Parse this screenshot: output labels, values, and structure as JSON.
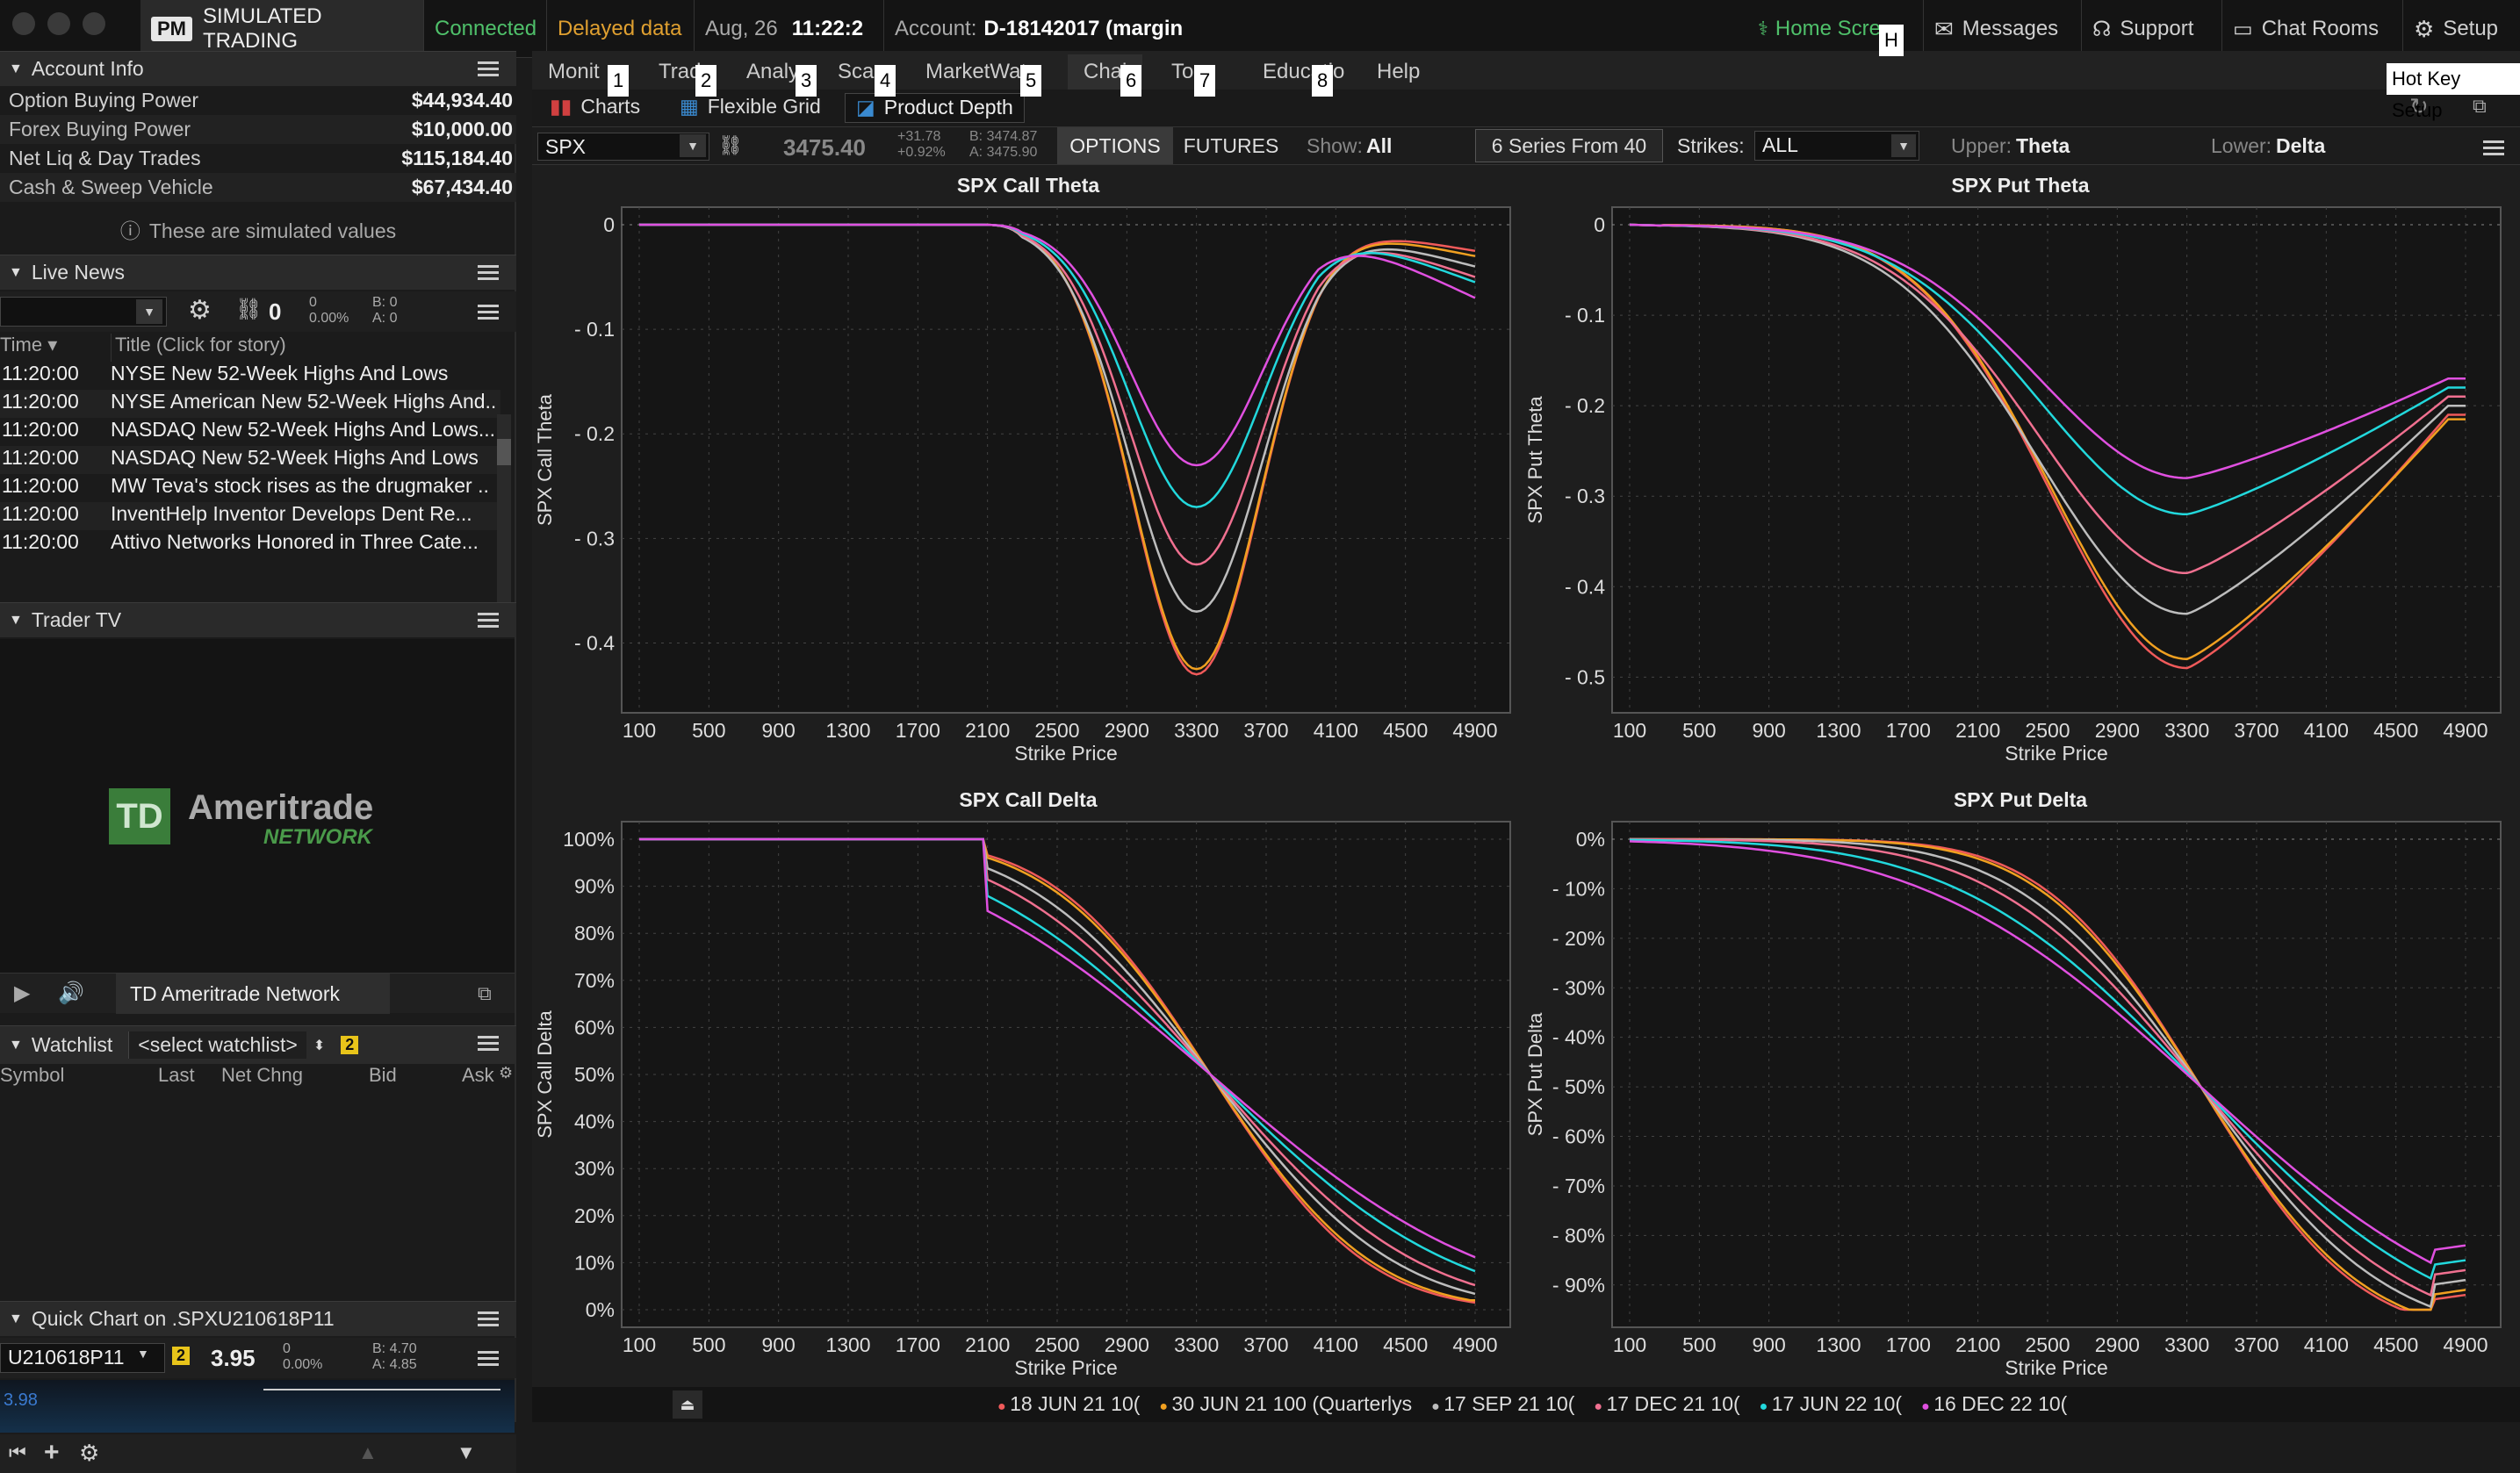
{
  "topbar": {
    "pm_badge": "PM",
    "mode": "SIMULATED TRADING",
    "connection": "Connected",
    "data_status": "Delayed data",
    "date": "Aug, 26",
    "time": "11:22:2",
    "account_label": "Account:",
    "account_value": "D-18142017 (margin",
    "home_screen": "Home Scre",
    "messages": "Messages",
    "support": "Support",
    "chat_rooms": "Chat Rooms",
    "setup": "Setup",
    "hotkey_h": "H",
    "hotkey_setup": "Hot Key Setup"
  },
  "account_info": {
    "title": "Account Info",
    "rows": [
      {
        "label": "Option Buying Power",
        "value": "$44,934.40"
      },
      {
        "label": "Forex Buying Power",
        "value": "$10,000.00"
      },
      {
        "label": "Net Liq & Day Trades",
        "value": "$115,184.40"
      },
      {
        "label": "Cash & Sweep Vehicle",
        "value": "$67,434.40"
      }
    ],
    "simulated_note": "These are simulated values"
  },
  "live_news": {
    "title": "Live News",
    "count": "0",
    "pct_top": "0",
    "pct_bottom": "0.00%",
    "bid": "B: 0",
    "ask": "A: 0",
    "col_time": "Time",
    "col_title": "Title (Click for story)",
    "rows": [
      {
        "time": "11:20:00",
        "title": "NYSE New 52-Week Highs And Lows"
      },
      {
        "time": "11:20:00",
        "title": "NYSE American New 52-Week Highs And..."
      },
      {
        "time": "11:20:00",
        "title": "NASDAQ New 52-Week Highs And Lows..."
      },
      {
        "time": "11:20:00",
        "title": "NASDAQ New 52-Week Highs And Lows"
      },
      {
        "time": "11:20:00",
        "title": "MW Teva's stock rises as the drugmaker .."
      },
      {
        "time": "11:20:00",
        "title": "InventHelp Inventor Develops Dent Re..."
      },
      {
        "time": "11:20:00",
        "title": "Attivo Networks Honored in Three Cate..."
      }
    ]
  },
  "trader_tv": {
    "title": "Trader TV",
    "logo_main": "Ameritrade",
    "logo_sub": "NETWORK",
    "logo_badge": "TD",
    "channel": "TD Ameritrade Network"
  },
  "watchlist": {
    "title": "Watchlist",
    "select": "<select watchlist>",
    "badge": "2",
    "cols": [
      "Symbol",
      "Last",
      "Net Chng",
      "Bid",
      "Ask"
    ]
  },
  "quick_chart": {
    "title": "Quick Chart on .SPXU210618P11",
    "symbol": "U210618P11",
    "badge": "2",
    "price": "3.95",
    "chg_top": "0",
    "chg_bottom": "0.00%",
    "bid": "B: 4.70",
    "ask": "A: 4.85",
    "spark_value": "3.98"
  },
  "main": {
    "tabs": [
      {
        "label": "Monit",
        "hotkey": "1"
      },
      {
        "label": "Trad",
        "hotkey": "2"
      },
      {
        "label": "Analy",
        "hotkey": "3"
      },
      {
        "label": "Sca",
        "hotkey": "4"
      },
      {
        "label": "MarketWat",
        "hotkey": "5"
      },
      {
        "label": "Chai",
        "hotkey": "6"
      },
      {
        "label": "Too",
        "hotkey": "7"
      },
      {
        "label": "Educatio",
        "hotkey": "8"
      },
      {
        "label": "Help",
        "hotkey": ""
      }
    ],
    "subtabs": [
      "Charts",
      "Flexible Grid",
      "Product Depth"
    ],
    "symbol": "SPX",
    "last_price": "3475.40",
    "change": "+31.78",
    "change_pct": "+0.92%",
    "bid": "B: 3474.87",
    "ask": "A: 3475.90",
    "options_btn": "OPTIONS",
    "futures_btn": "FUTURES",
    "show_label": "Show:",
    "show_value": "All",
    "series": "6 Series From 40",
    "strikes_label": "Strikes:",
    "strikes_value": "ALL",
    "upper_label": "Upper:",
    "upper_value": "Theta",
    "lower_label": "Lower:",
    "lower_value": "Delta"
  },
  "legend": [
    {
      "label": "18 JUN 21 10(",
      "color": "#f05a5a"
    },
    {
      "label": "30 JUN 21 100 (Quarterlys",
      "color": "#f0a020"
    },
    {
      "label": "17 SEP 21 10(",
      "color": "#bdbdbd"
    },
    {
      "label": "17 DEC 21 10(",
      "color": "#f07090"
    },
    {
      "label": "17 JUN 22 10(",
      "color": "#22d8dc"
    },
    {
      "label": "16 DEC 22 10(",
      "color": "#e050e0"
    }
  ],
  "chart_data": [
    {
      "type": "line",
      "title": "SPX Call Theta",
      "xlabel": "Strike Price",
      "ylabel": "SPX Call Theta",
      "xticks": [
        "100",
        "500",
        "900",
        "1300",
        "1700",
        "2100",
        "2500",
        "2900",
        "3300",
        "3700",
        "4100",
        "4500",
        "4900"
      ],
      "yticks": [
        "0",
        "- 0.1",
        "- 0.2",
        "- 0.3",
        "- 0.4"
      ],
      "ylim": [
        -0.45,
        0.0
      ],
      "series": [
        {
          "min": -0.43,
          "end": -0.025
        },
        {
          "min": -0.425,
          "end": -0.03
        },
        {
          "min": -0.37,
          "end": -0.04
        },
        {
          "min": -0.325,
          "end": -0.05
        },
        {
          "min": -0.27,
          "end": -0.055
        },
        {
          "min": -0.23,
          "end": -0.07
        }
      ]
    },
    {
      "type": "line",
      "title": "SPX Put Theta",
      "xlabel": "Strike Price",
      "ylabel": "SPX Put Theta",
      "xticks": [
        "100",
        "500",
        "900",
        "1300",
        "1700",
        "2100",
        "2500",
        "2900",
        "3300",
        "3700",
        "4100",
        "4500",
        "4900"
      ],
      "yticks": [
        "0",
        "- 0.1",
        "- 0.2",
        "- 0.3",
        "- 0.4",
        "- 0.5"
      ],
      "ylim": [
        -0.52,
        0.0
      ],
      "series": [
        {
          "min": -0.49,
          "end": -0.21
        },
        {
          "min": -0.48,
          "end": -0.215
        },
        {
          "min": -0.43,
          "end": -0.2
        },
        {
          "min": -0.385,
          "end": -0.19
        },
        {
          "min": -0.32,
          "end": -0.18
        },
        {
          "min": -0.28,
          "end": -0.17
        }
      ]
    },
    {
      "type": "line",
      "title": "SPX Call Delta",
      "xlabel": "Strike Price",
      "ylabel": "SPX Call Delta",
      "xticks": [
        "100",
        "500",
        "900",
        "1300",
        "1700",
        "2100",
        "2500",
        "2900",
        "3300",
        "3700",
        "4100",
        "4500",
        "4900"
      ],
      "yticks": [
        "100%",
        "90%",
        "80%",
        "70%",
        "60%",
        "50%",
        "40%",
        "30%",
        "20%",
        "10%",
        "0%"
      ],
      "ylim": [
        0,
        100
      ],
      "series": [
        {
          "k": 270,
          "end": 1
        },
        {
          "k": 280,
          "end": 2
        },
        {
          "k": 320,
          "end": 3
        },
        {
          "k": 360,
          "end": 4
        },
        {
          "k": 420,
          "end": 5
        },
        {
          "k": 480,
          "end": 7
        }
      ]
    },
    {
      "type": "line",
      "title": "SPX Put Delta",
      "xlabel": "Strike Price",
      "ylabel": "SPX Put Delta",
      "xticks": [
        "100",
        "500",
        "900",
        "1300",
        "1700",
        "2100",
        "2500",
        "2900",
        "3300",
        "3700",
        "4100",
        "4500",
        "4900"
      ],
      "yticks": [
        "0%",
        "- 10%",
        "- 20%",
        "- 30%",
        "- 40%",
        "- 50%",
        "- 60%",
        "- 70%",
        "- 80%",
        "- 90%"
      ],
      "ylim": [
        -95,
        0
      ],
      "series": [
        {
          "k": 270,
          "end": -92
        },
        {
          "k": 280,
          "end": -91
        },
        {
          "k": 320,
          "end": -89
        },
        {
          "k": 360,
          "end": -87
        },
        {
          "k": 420,
          "end": -85
        },
        {
          "k": 480,
          "end": -82
        }
      ]
    }
  ]
}
